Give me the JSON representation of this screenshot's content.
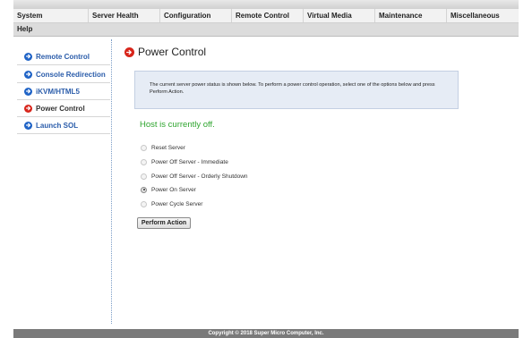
{
  "menu": {
    "row1": [
      "System",
      "Server Health",
      "Configuration",
      "Remote Control",
      "Virtual Media",
      "Maintenance",
      "Miscellaneous"
    ],
    "help": "Help"
  },
  "sidebar": {
    "items": [
      {
        "label": "Remote Control",
        "icon": "arrow-right-circle-icon",
        "color": "#1f63c6"
      },
      {
        "label": "Console Redirection",
        "icon": "arrow-right-circle-icon",
        "color": "#1f63c6"
      },
      {
        "label": "iKVM/HTML5",
        "icon": "arrow-right-circle-icon",
        "color": "#1f63c6"
      },
      {
        "label": "Power Control",
        "icon": "arrow-right-circle-icon",
        "color": "#d8251b",
        "active": true
      },
      {
        "label": "Launch SOL",
        "icon": "arrow-right-circle-icon",
        "color": "#1f63c6"
      }
    ]
  },
  "page": {
    "title": "Power Control",
    "info": "The current server power status is shown below. To perform a power control operation, select one of the options below and press Perform Action.",
    "host_status": "Host is currently off.",
    "options": [
      {
        "label": "Reset Server",
        "checked": false
      },
      {
        "label": "Power Off Server - Immediate",
        "checked": false
      },
      {
        "label": "Power Off Server - Orderly Shutdown",
        "checked": false
      },
      {
        "label": "Power On Server",
        "checked": true
      },
      {
        "label": "Power Cycle Server",
        "checked": false
      }
    ],
    "perform_label": "Perform Action"
  },
  "footer": {
    "copyright": "Copyright © 2018 Super Micro Computer, Inc."
  },
  "colors": {
    "accent_blue": "#2a5caa",
    "status_green": "#2ea52e",
    "active_red": "#d8251b"
  }
}
